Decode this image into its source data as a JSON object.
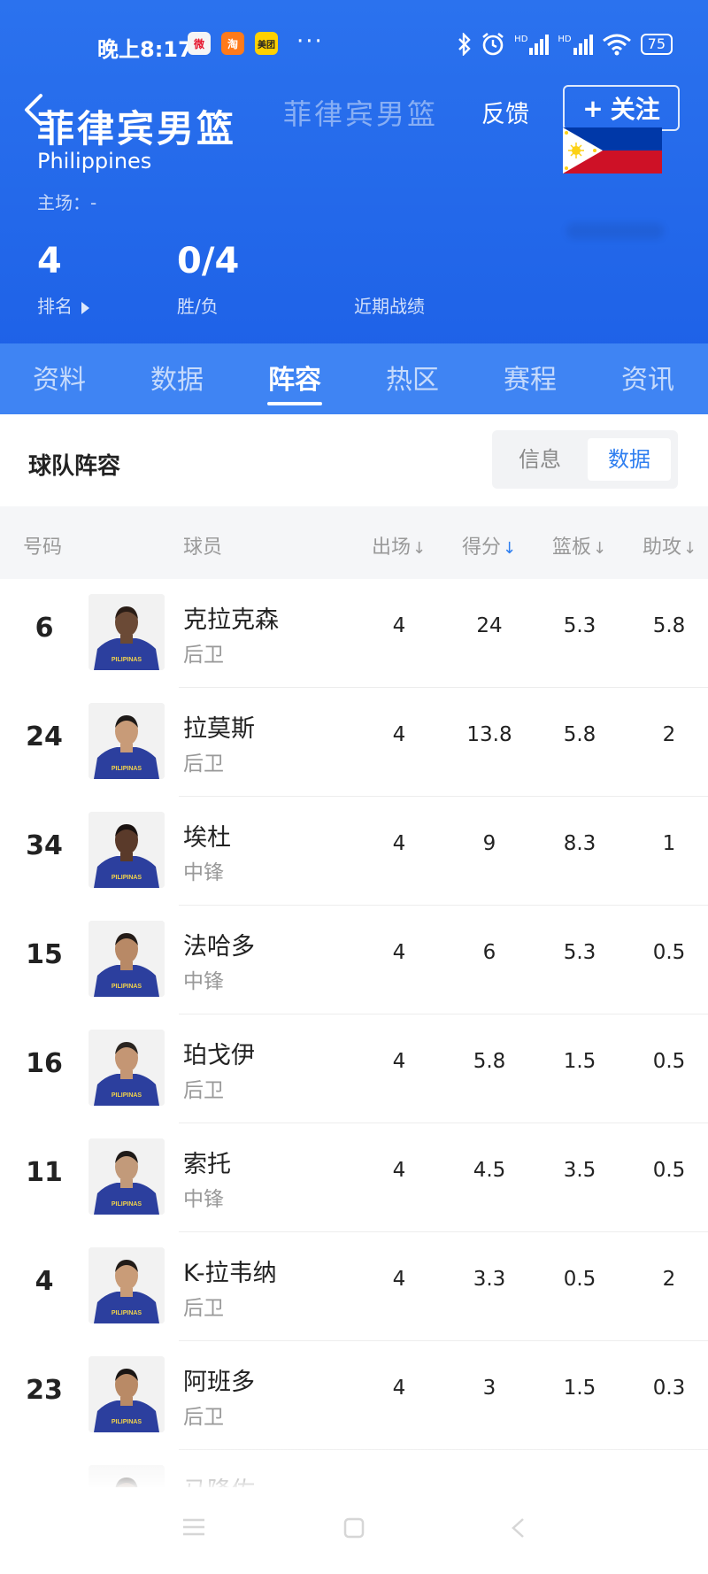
{
  "status": {
    "time": "晚上8:17",
    "apps": [
      {
        "name": "weibo-icon",
        "text": "微",
        "bg": "#f5f5f5",
        "fg": "#e6162d"
      },
      {
        "name": "taobao-icon",
        "text": "淘",
        "bg": "#ff7a1a",
        "fg": "#ffffff"
      },
      {
        "name": "meituan-icon",
        "text": "美团",
        "bg": "#ffd100",
        "fg": "#222222"
      }
    ],
    "more": "···",
    "network1": "HD",
    "network2": "HD",
    "battery": "75"
  },
  "header": {
    "team_cn": "菲律宾男篮",
    "team_en": "Philippines",
    "home_ground": "主场：-",
    "ghost_title": "菲律宾男篮",
    "feedback": "反馈",
    "follow": "关注",
    "rank_value": "4",
    "rank_label": "排名",
    "wl_value": "0/4",
    "wl_label": "胜/负",
    "recent_label": "近期战绩"
  },
  "tabs": [
    {
      "label": "资料",
      "active": false
    },
    {
      "label": "数据",
      "active": false
    },
    {
      "label": "阵容",
      "active": true
    },
    {
      "label": "热区",
      "active": false
    },
    {
      "label": "赛程",
      "active": false
    },
    {
      "label": "资讯",
      "active": false
    }
  ],
  "section": {
    "title": "球队阵容",
    "toggle_info": "信息",
    "toggle_data": "数据"
  },
  "table": {
    "columns": [
      "号码",
      "球员",
      "出场",
      "得分",
      "篮板",
      "助攻"
    ],
    "sort_arrow": "↓",
    "rows": [
      {
        "number": "6",
        "name": "克拉克森",
        "position": "后卫",
        "apps": "4",
        "points": "24",
        "rebounds": "5.3",
        "assists": "5.8",
        "skin": "#6b4a36",
        "hair": "#2a1d16"
      },
      {
        "number": "24",
        "name": "拉莫斯",
        "position": "后卫",
        "apps": "4",
        "points": "13.8",
        "rebounds": "5.8",
        "assists": "2",
        "skin": "#c89b78",
        "hair": "#1e1a18"
      },
      {
        "number": "34",
        "name": "埃杜",
        "position": "中锋",
        "apps": "4",
        "points": "9",
        "rebounds": "8.3",
        "assists": "1",
        "skin": "#5a3a2a",
        "hair": "#1a1210"
      },
      {
        "number": "15",
        "name": "法哈多",
        "position": "中锋",
        "apps": "4",
        "points": "6",
        "rebounds": "5.3",
        "assists": "0.5",
        "skin": "#b88966",
        "hair": "#241c18"
      },
      {
        "number": "16",
        "name": "珀戈伊",
        "position": "后卫",
        "apps": "4",
        "points": "5.8",
        "rebounds": "1.5",
        "assists": "0.5",
        "skin": "#c49674",
        "hair": "#2a2420"
      },
      {
        "number": "11",
        "name": "索托",
        "position": "中锋",
        "apps": "4",
        "points": "4.5",
        "rebounds": "3.5",
        "assists": "0.5",
        "skin": "#c29a7a",
        "hair": "#1e1a18"
      },
      {
        "number": "4",
        "name": "K-拉韦纳",
        "position": "后卫",
        "apps": "4",
        "points": "3.3",
        "rebounds": "0.5",
        "assists": "2",
        "skin": "#c99c78",
        "hair": "#221c18"
      },
      {
        "number": "23",
        "name": "阿班多",
        "position": "后卫",
        "apps": "4",
        "points": "3",
        "rebounds": "1.5",
        "assists": "0.3",
        "skin": "#b98a66",
        "hair": "#1a1614"
      },
      {
        "number": "",
        "name": "马隆佐",
        "position": "",
        "apps": "",
        "points": "",
        "rebounds": "",
        "assists": "",
        "skin": "#7a563f",
        "hair": "#1a1614"
      }
    ],
    "jersey_text": "PILIPINAS",
    "jersey_color": "#2c3f9e"
  },
  "colors": {
    "header_blue": "#1f62e8",
    "tab_bar_blue": "#3f84f3",
    "accent": "#2e7ef0",
    "flag_blue": "#0038a8",
    "flag_red": "#ce1126",
    "flag_sun": "#fcd116"
  }
}
